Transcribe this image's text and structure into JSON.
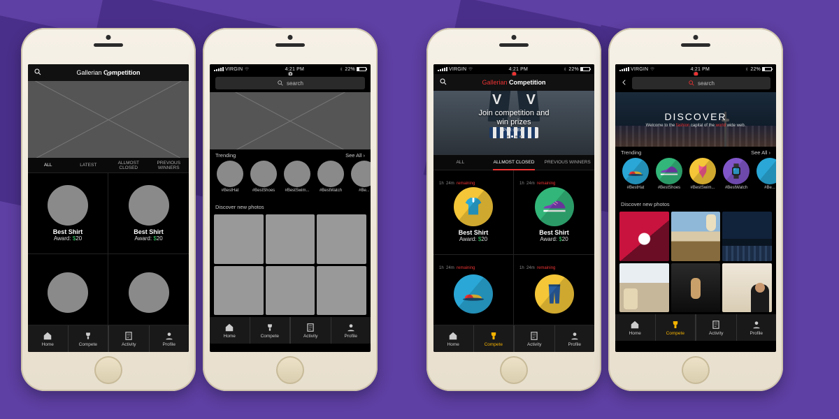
{
  "status": {
    "carrier": "VIRGIN",
    "time": "4:21 PM",
    "battery": "22%"
  },
  "brand": {
    "gallerian": "Gallerian",
    "competition": "Competition"
  },
  "search": {
    "placeholder": "search"
  },
  "tabsCompete": [
    "ALL",
    "LATEST",
    "ALLMOST CLOSED",
    "PREVIOUS WINNERS"
  ],
  "tabsCompeteC": [
    "ALL",
    "ALLMOST CLOSED",
    "PREVIOUS WINNERS"
  ],
  "competition": {
    "items": [
      {
        "name": "Best Shirt",
        "award_prefix": "Award: ",
        "currency": "$",
        "amount": "20",
        "timer_h": "1h",
        "timer_m": "24m",
        "timer_label": "remaining"
      },
      {
        "name": "Best Shirt",
        "award_prefix": "Award: ",
        "currency": "$",
        "amount": "20",
        "timer_h": "1h",
        "timer_m": "24m",
        "timer_label": "remaining"
      }
    ]
  },
  "trending": {
    "title": "Trending",
    "see_all": "See All ›",
    "chips": [
      "#BestHat",
      "#BestShoes",
      "#BestSwim...",
      "#BestWatch",
      "#Be..."
    ]
  },
  "discover": {
    "title_section": "Discover new photos",
    "hero_title": "DISCOVER",
    "hero_sub_pre": "Welcome to the ",
    "hero_sub_em1": "fashion",
    "hero_sub_mid": " capital of the ",
    "hero_sub_em2": "world",
    "hero_sub_post": " wide web."
  },
  "compete_hero": {
    "line1": "Join competition and",
    "line2": "win prizes",
    "sub": "Post selfies"
  },
  "tabbar": {
    "home": "Home",
    "compete": "Compete",
    "activity": "Activity",
    "profile": "Profile"
  }
}
